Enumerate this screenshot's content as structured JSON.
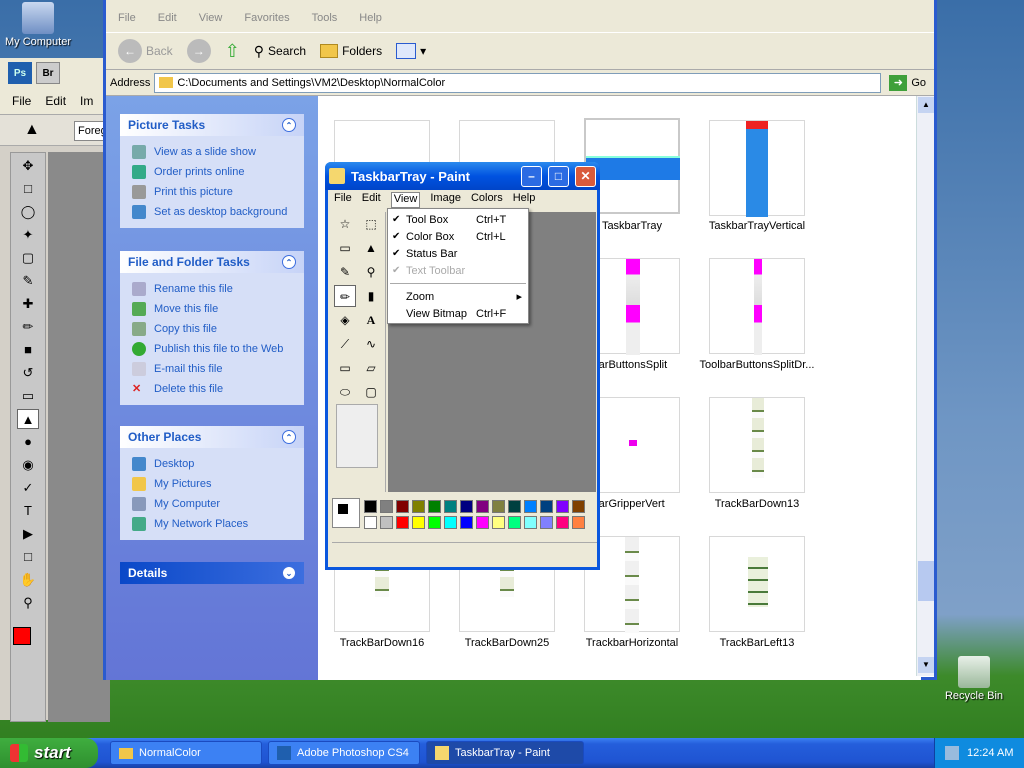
{
  "desktop": {
    "my_computer": "My Computer",
    "recycle_bin": "Recycle Bin"
  },
  "photoshop": {
    "top_buttons": [
      "Ps",
      "Br"
    ],
    "menu": [
      "File",
      "Edit",
      "Im"
    ],
    "option": "Foreg"
  },
  "explorer": {
    "menu": [
      "File",
      "Edit",
      "View",
      "Favorites",
      "Tools",
      "Help"
    ],
    "toolbar": {
      "back": "Back",
      "search": "Search",
      "folders": "Folders"
    },
    "address_label": "Address",
    "address": "C:\\Documents and Settings\\VM2\\Desktop\\NormalColor",
    "go": "Go",
    "picture_tasks": {
      "title": "Picture Tasks",
      "items": [
        "View as a slide show",
        "Order prints online",
        "Print this picture",
        "Set as desktop background"
      ]
    },
    "file_tasks": {
      "title": "File and Folder Tasks",
      "items": [
        "Rename this file",
        "Move this file",
        "Copy this file",
        "Publish this file to the Web",
        "E-mail this file",
        "Delete this file"
      ]
    },
    "other_places": {
      "title": "Other Places",
      "items": [
        "Desktop",
        "My Pictures",
        "My Computer",
        "My Network Places"
      ]
    },
    "details": {
      "title": "Details"
    },
    "files": [
      {
        "name": "TaskbarTray"
      },
      {
        "name": "TaskbarTrayVertical"
      },
      {
        "name": "olbarButtonsSplit"
      },
      {
        "name": "ToolbarButtonsSplitDr..."
      },
      {
        "name": "olbarGripperVert"
      },
      {
        "name": "TrackBarDown13"
      },
      {
        "name": "TrackBarDown16"
      },
      {
        "name": "TrackBarDown25"
      },
      {
        "name": "TrackbarHorizontal"
      },
      {
        "name": "TrackBarLeft13"
      }
    ]
  },
  "paint": {
    "title": "TaskbarTray - Paint",
    "menu": [
      "File",
      "Edit",
      "View",
      "Image",
      "Colors",
      "Help"
    ],
    "view_menu": [
      {
        "label": "Tool Box",
        "shortcut": "Ctrl+T",
        "checked": true,
        "disabled": false
      },
      {
        "label": "Color Box",
        "shortcut": "Ctrl+L",
        "checked": true,
        "disabled": false
      },
      {
        "label": "Status Bar",
        "shortcut": "",
        "checked": true,
        "disabled": false
      },
      {
        "label": "Text Toolbar",
        "shortcut": "",
        "checked": true,
        "disabled": true
      },
      {
        "label": "Zoom",
        "shortcut": "",
        "checked": false,
        "disabled": false
      },
      {
        "label": "View Bitmap",
        "shortcut": "Ctrl+F",
        "checked": false,
        "disabled": false
      }
    ],
    "palette": [
      "#000000",
      "#808080",
      "#800000",
      "#808000",
      "#008000",
      "#008080",
      "#000080",
      "#800080",
      "#808040",
      "#004040",
      "#0080ff",
      "#004080",
      "#8000ff",
      "#804000",
      "#ffffff",
      "#c0c0c0",
      "#ff0000",
      "#ffff00",
      "#00ff00",
      "#00ffff",
      "#0000ff",
      "#ff00ff",
      "#ffff80",
      "#00ff80",
      "#80ffff",
      "#8080ff",
      "#ff0080",
      "#ff8040"
    ]
  },
  "taskbar": {
    "start": "start",
    "tasks": [
      "NormalColor",
      "Adobe Photoshop CS4",
      "TaskbarTray - Paint"
    ],
    "clock": "12:24 AM"
  }
}
